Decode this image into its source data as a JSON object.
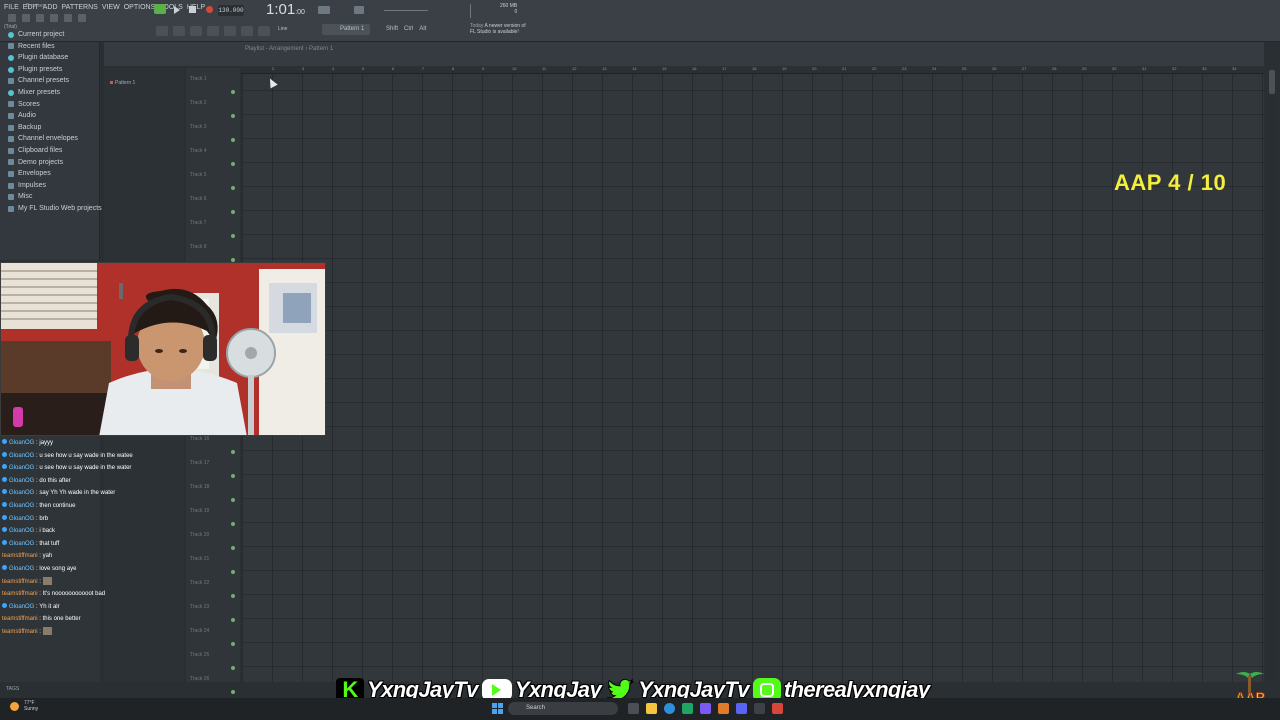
{
  "menu": [
    "FILE",
    "EDIT",
    "ADD",
    "PATTERNS",
    "VIEW",
    "OPTIONS",
    "TOOLS",
    "HELP"
  ],
  "app": {
    "trial_label": "(Trial)",
    "tempo": "130.000",
    "time": "1:01",
    "time_small": ":00",
    "ram": "260 MB",
    "cpu": "0",
    "pattern": "Pattern 1",
    "snap": "Line",
    "modifiers": [
      "Shift",
      "Ctrl",
      "Alt"
    ],
    "update_today": "Today",
    "update_text": "A newer version of",
    "update_text2": "FL Studio is available!"
  },
  "browser": {
    "title": "Browser",
    "items": [
      {
        "label": "Current project",
        "type": "tree"
      },
      {
        "label": "Recent files",
        "type": "folder"
      },
      {
        "label": "Plugin database",
        "type": "tree"
      },
      {
        "label": "Plugin presets",
        "type": "tree"
      },
      {
        "label": "Channel presets",
        "type": "folder"
      },
      {
        "label": "Mixer presets",
        "type": "tree"
      },
      {
        "label": "Scores",
        "type": "folder"
      },
      {
        "label": "Audio",
        "type": "folder"
      },
      {
        "label": "Backup",
        "type": "folder"
      },
      {
        "label": "Channel envelopes",
        "type": "folder"
      },
      {
        "label": "Clipboard files",
        "type": "folder"
      },
      {
        "label": "Demo projects",
        "type": "folder"
      },
      {
        "label": "Envelopes",
        "type": "folder"
      },
      {
        "label": "Impulses",
        "type": "folder"
      },
      {
        "label": "Misc",
        "type": "folder"
      },
      {
        "label": "My FL Studio Web projects",
        "type": "folder"
      }
    ],
    "tags_label": "TAGS"
  },
  "playlist": {
    "title": "Playlist - Arrangement › Pattern 1",
    "pattern_item": "Pattern 1",
    "tracks_top": [
      "Track 1",
      "Track 2",
      "Track 3",
      "Track 4",
      "Track 5",
      "Track 6",
      "Track 7",
      "Track 8"
    ],
    "tracks_bottom": [
      "Track 16",
      "Track 17",
      "Track 18",
      "Track 19",
      "Track 20",
      "Track 21",
      "Track 22",
      "Track 23",
      "Track 24",
      "Track 25",
      "Track 26"
    ],
    "ruler": [
      "2",
      "3",
      "4",
      "5",
      "6",
      "7",
      "8",
      "9",
      "10",
      "11",
      "12",
      "13",
      "14",
      "15",
      "16",
      "17",
      "18",
      "19",
      "20",
      "21",
      "22",
      "23",
      "24",
      "25",
      "26",
      "27",
      "28",
      "29",
      "30",
      "31",
      "32",
      "33",
      "34"
    ]
  },
  "overlay": {
    "aap_counter": "AAP 4 / 10",
    "socials": [
      {
        "icon": "kick-icon",
        "label": "YxngJayTv"
      },
      {
        "icon": "youtube-icon",
        "label": "YxngJay"
      },
      {
        "icon": "twitter-icon",
        "label": "YxngJayTv"
      },
      {
        "icon": "instagram-icon",
        "label": "therealyxngjay"
      }
    ]
  },
  "chat": [
    {
      "user": "GloanOG",
      "msg": "jayyy",
      "color": "blue"
    },
    {
      "user": "GloanOG",
      "msg": "u see how u say wade in the watee",
      "color": "blue"
    },
    {
      "user": "GloanOG",
      "msg": "u see how u say wade in the water",
      "color": "blue"
    },
    {
      "user": "GloanOG",
      "msg": "do this after",
      "color": "blue"
    },
    {
      "user": "GloanOG",
      "msg": "say Yh Yh wade in the water",
      "color": "blue"
    },
    {
      "user": "GloanOG",
      "msg": "then continue",
      "color": "blue"
    },
    {
      "user": "GloanOG",
      "msg": "brb",
      "color": "blue"
    },
    {
      "user": "GloanOG",
      "msg": "i back",
      "color": "blue"
    },
    {
      "user": "GloanOG",
      "msg": "that tuff",
      "color": "blue"
    },
    {
      "user": "teamstiffmani",
      "msg": "yah",
      "color": "orange"
    },
    {
      "user": "GloanOG",
      "msg": "love song aye",
      "color": "blue"
    },
    {
      "user": "teamstiffmani",
      "msg": "",
      "color": "orange",
      "emote": true
    },
    {
      "user": "teamstiffmani",
      "msg": "It's nooooooooooot bad",
      "color": "orange"
    },
    {
      "user": "GloanOG",
      "msg": "Yh it alr",
      "color": "blue"
    },
    {
      "user": "teamstiffmani",
      "msg": "this one better",
      "color": "orange"
    },
    {
      "user": "teamstiffmani",
      "msg": "",
      "color": "orange",
      "emote": true
    }
  ],
  "taskbar": {
    "temp": "77°F",
    "weather": "Sunny",
    "search": "Search"
  },
  "colors": {
    "accent_yellow": "#f4ef3a",
    "social_green": "#53fc18"
  }
}
